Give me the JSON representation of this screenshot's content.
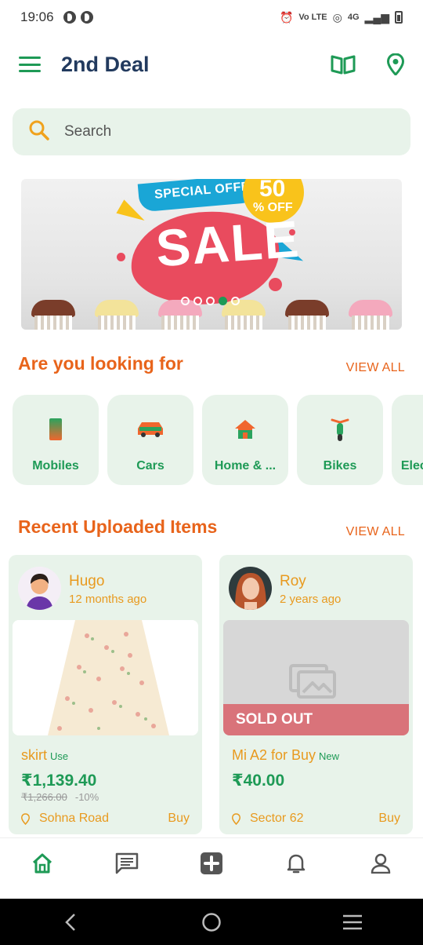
{
  "status_bar": {
    "time": "19:06",
    "network": "4G"
  },
  "app_bar": {
    "title": "2nd Deal",
    "accent": "#1e9a56"
  },
  "search": {
    "placeholder": "Search"
  },
  "banner": {
    "offer_text": "SPECIAL OFFER",
    "sale_text": "SALE",
    "percent_big": "50",
    "percent_small": "% OFF",
    "slide_count": 5,
    "active_slide": 3
  },
  "looking_for": {
    "title": "Are you looking for",
    "view_all": "VIEW ALL",
    "categories": [
      {
        "label": "Mobiles",
        "icon": "mobile-icon"
      },
      {
        "label": "Cars",
        "icon": "car-icon"
      },
      {
        "label": "Home & ...",
        "icon": "home-icon"
      },
      {
        "label": "Bikes",
        "icon": "scooter-icon"
      },
      {
        "label": "Electronics",
        "icon": "electronics-icon"
      }
    ]
  },
  "recent": {
    "title": "Recent Uploaded Items",
    "view_all": "VIEW ALL",
    "items": [
      {
        "user": "Hugo",
        "ago": "12 months ago",
        "name": "skirt",
        "condition": "Use",
        "price": "₹1,139.40",
        "old_price": "₹1,266.00",
        "discount": "-10%",
        "location": "Sohna Road",
        "action": "Buy"
      },
      {
        "user": "Roy",
        "ago": "2 years ago",
        "name": "Mi A2 for Buy",
        "condition": "New",
        "price": "₹40.00",
        "status": "SOLD OUT",
        "location": "Sector 62",
        "action": "Buy"
      }
    ]
  },
  "bottom_nav": [
    "home-icon",
    "chat-icon",
    "add-icon",
    "bell-icon",
    "profile-icon"
  ],
  "system_nav": [
    "back-icon",
    "home-circle-icon",
    "recents-icon"
  ]
}
